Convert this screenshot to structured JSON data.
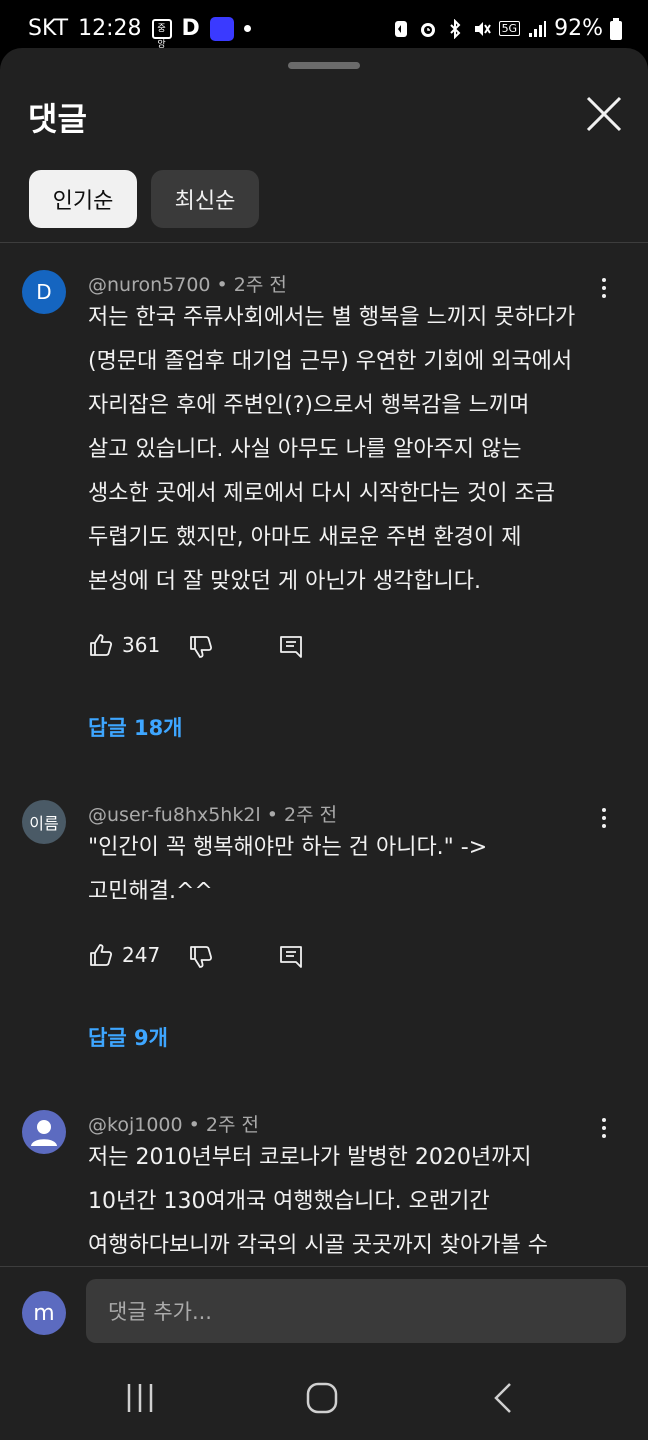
{
  "status_bar": {
    "carrier": "SKT",
    "time": "12:28",
    "network": "5G",
    "battery": "92%"
  },
  "sheet": {
    "title": "댓글",
    "sort_chips": [
      {
        "label": "인기순",
        "active": true
      },
      {
        "label": "최신순",
        "active": false
      }
    ]
  },
  "comments": [
    {
      "avatar_letter": "D",
      "avatar_color": "#1565c0",
      "author": "@nuron5700",
      "time": "2주 전",
      "lines": [
        "저는 한국 주류사회에서는 별 행복을 느끼지 못하다가",
        "(명문대 졸업후 대기업 근무) 우연한 기회에 외국에서",
        "자리잡은 후에 주변인(?)으로서 행복감을 느끼며",
        "살고 있습니다. 사실 아무도 나를 알아주지 않는",
        "생소한 곳에서 제로에서 다시 시작한다는 것이 조금",
        "두렵기도 했지만, 아마도 새로운 주변 환경이 제",
        "본성에 더 잘 맞았던 게 아닌가 생각합니다."
      ],
      "likes": "361",
      "replies": "답글 18개"
    },
    {
      "avatar_letter": "이름",
      "avatar_color": "#4a5a66",
      "author": "@user-fu8hx5hk2l",
      "time": "2주 전",
      "lines": [
        "\"인간이 꼭 행복해야만 하는 건 아니다.\" ->",
        "고민해결.^^"
      ],
      "likes": "247",
      "replies": "답글 9개"
    },
    {
      "avatar_letter": "",
      "avatar_color": "#5c6bc0",
      "author": "@koj1000",
      "time": "2주 전",
      "lines": [
        "저는 2010년부터 코로나가 발병한 2020년까지",
        "10년간 130여개국 여행했습니다. 오랜기간",
        "여행하다보니까 각국의 시골 곳곳까지 찾아가볼 수"
      ]
    }
  ],
  "composer": {
    "avatar_letter": "m",
    "placeholder": "댓글 추가..."
  }
}
